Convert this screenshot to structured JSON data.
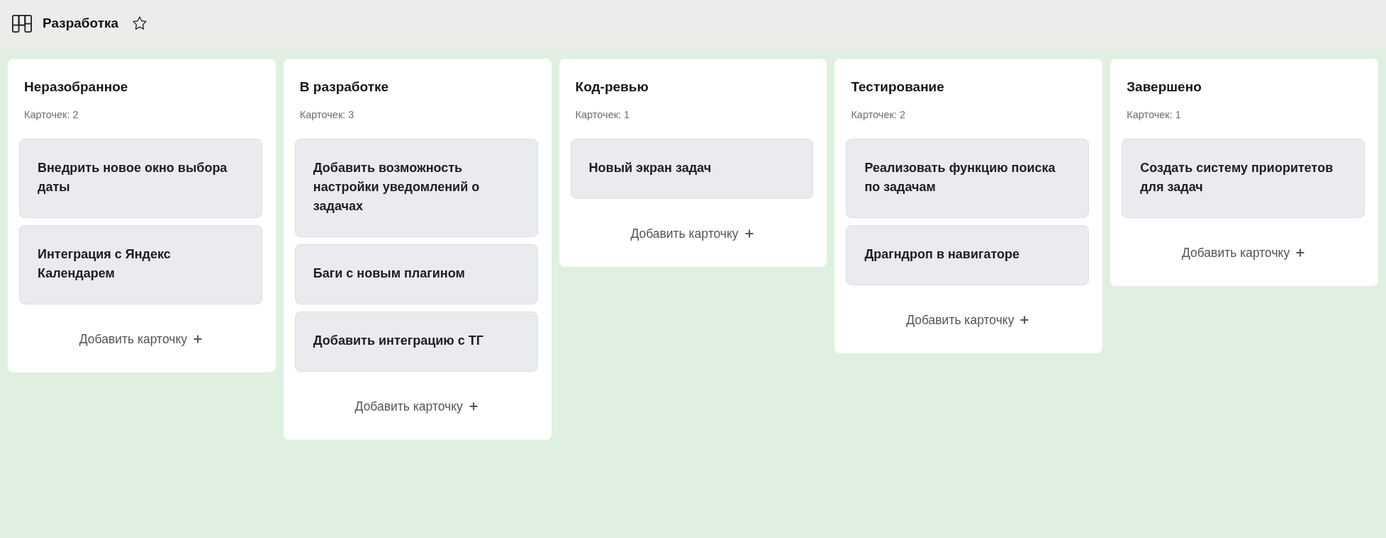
{
  "board": {
    "title": "Разработка",
    "starred": false
  },
  "columns": [
    {
      "title": "Неразобранное",
      "count": "Карточек: 2",
      "cards": [
        {
          "title": "Внедрить новое окно выбора даты"
        },
        {
          "title": "Интеграция с Яндекс Календарем"
        }
      ],
      "add_button": "Добавить карточку"
    },
    {
      "title": "В разработке",
      "count": "Карточек: 3",
      "cards": [
        {
          "title": "Добавить возможность настройки уведомлений о задачах"
        },
        {
          "title": "Баги с новым плагином"
        },
        {
          "title": "Добавить интеграцию с ТГ"
        }
      ],
      "add_button": "Добавить карточку"
    },
    {
      "title": "Код-ревью",
      "count": "Карточек: 1",
      "cards": [
        {
          "title": "Новый экран задач"
        }
      ],
      "add_button": "Добавить карточку"
    },
    {
      "title": "Тестирование",
      "count": "Карточек: 2",
      "cards": [
        {
          "title": "Реализовать функцию поиска по задачам"
        },
        {
          "title": "Драгндроп в навигаторе"
        }
      ],
      "add_button": "Добавить карточку"
    },
    {
      "title": "Завершено",
      "count": "Карточек: 1",
      "cards": [
        {
          "title": "Создать систему приоритетов для задач"
        }
      ],
      "add_button": "Добавить карточку"
    }
  ]
}
